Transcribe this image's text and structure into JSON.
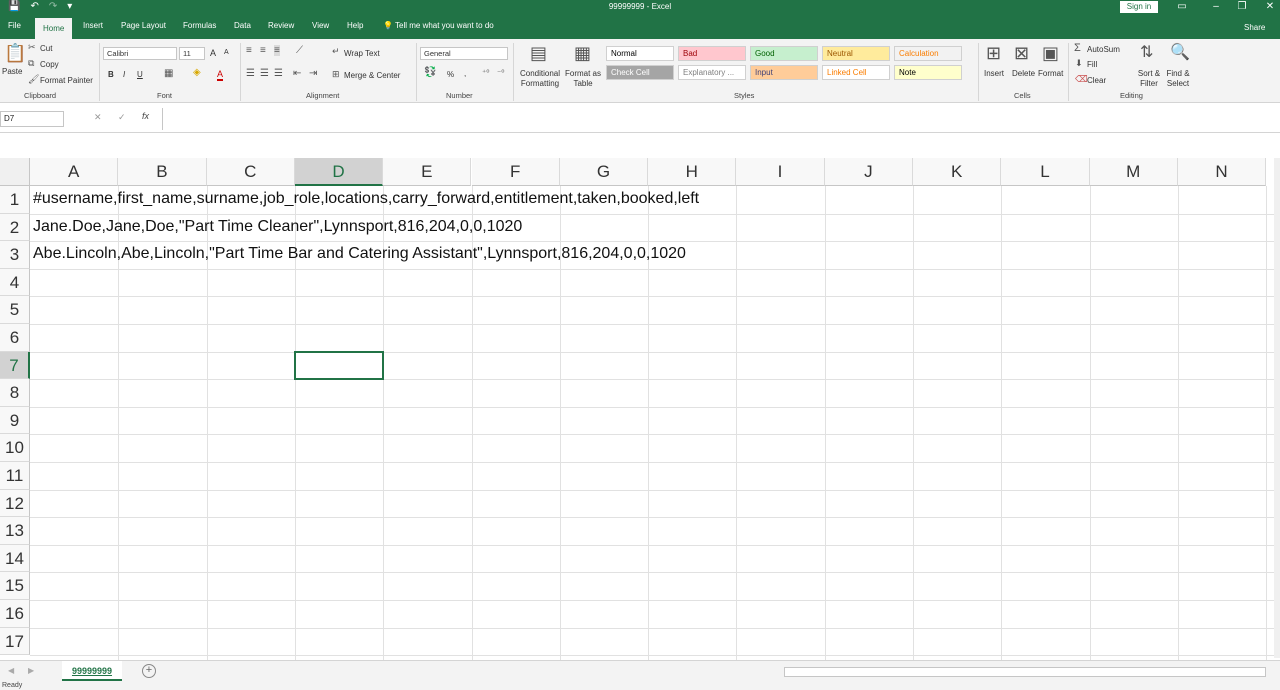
{
  "titlebar": {
    "doc_title": "99999999 - Excel",
    "signin": "Sign in"
  },
  "tabs": [
    {
      "label": "File"
    },
    {
      "label": "Home"
    },
    {
      "label": "Insert"
    },
    {
      "label": "Page Layout"
    },
    {
      "label": "Formulas"
    },
    {
      "label": "Data"
    },
    {
      "label": "Review"
    },
    {
      "label": "View"
    },
    {
      "label": "Help"
    },
    {
      "label": "Tell me what you want to do"
    }
  ],
  "share_label": "Share",
  "ribbon": {
    "clipboard": {
      "paste": "Paste",
      "cut": "Cut",
      "copy": "Copy",
      "format_painter": "Format Painter",
      "label": "Clipboard"
    },
    "font": {
      "name": "Calibri",
      "size": "11",
      "bold": "B",
      "italic": "I",
      "underline": "U",
      "grow": "A",
      "shrink": "A",
      "font_color": "A",
      "label": "Font"
    },
    "alignment": {
      "wrap_text": "Wrap Text",
      "merge_center": "Merge & Center",
      "label": "Alignment"
    },
    "number": {
      "format": "General",
      "percent": "%",
      "comma": ",",
      "label": "Number"
    },
    "styles": {
      "conditional": "Conditional Formatting",
      "format_as_table": "Format as Table",
      "cells": [
        {
          "label": "Normal",
          "bg": "#ffffff",
          "fg": "#000000"
        },
        {
          "label": "Bad",
          "bg": "#ffc7ce",
          "fg": "#9c0006"
        },
        {
          "label": "Good",
          "bg": "#c6efce",
          "fg": "#006100"
        },
        {
          "label": "Neutral",
          "bg": "#ffeb9c",
          "fg": "#9c5700"
        },
        {
          "label": "Calculation",
          "bg": "#f2f2f2",
          "fg": "#fa7d00"
        },
        {
          "label": "Check Cell",
          "bg": "#a5a5a5",
          "fg": "#ffffff"
        },
        {
          "label": "Explanatory ...",
          "bg": "#ffffff",
          "fg": "#7f7f7f"
        },
        {
          "label": "Input",
          "bg": "#ffcc99",
          "fg": "#3f3f76"
        },
        {
          "label": "Linked Cell",
          "bg": "#ffffff",
          "fg": "#fa7d00"
        },
        {
          "label": "Note",
          "bg": "#ffffcc",
          "fg": "#000000"
        }
      ],
      "label": "Styles"
    },
    "cells_group": {
      "insert": "Insert",
      "delete": "Delete",
      "format": "Format",
      "label": "Cells"
    },
    "editing": {
      "autosum": "AutoSum",
      "fill": "Fill",
      "clear": "Clear",
      "sort_filter": "Sort & Filter",
      "find_select": "Find & Select",
      "label": "Editing"
    }
  },
  "formula_bar": {
    "name_box": "D7",
    "fx": "fx",
    "cancel": "✕",
    "enter": "✓",
    "content": ""
  },
  "columns": [
    "A",
    "B",
    "C",
    "D",
    "E",
    "F",
    "G",
    "H",
    "I",
    "J",
    "K",
    "L",
    "M",
    "N"
  ],
  "rows": [
    "1",
    "2",
    "3",
    "4",
    "5",
    "6",
    "7",
    "8",
    "9",
    "10",
    "11",
    "12",
    "13",
    "14",
    "15",
    "16",
    "17"
  ],
  "cells": [
    {
      "row": "1",
      "text": "#username,first_name,surname,job_role,locations,carry_forward,entitlement,taken,booked,left"
    },
    {
      "row": "2",
      "text": "Jane.Doe,Jane,Doe,\"Part Time Cleaner\",Lynnsport,816,204,0,0,1020"
    },
    {
      "row": "3",
      "text": "Abe.Lincoln,Abe,Lincoln,\"Part Time Bar and Catering Assistant\",Lynnsport,816,204,0,0,1020"
    }
  ],
  "selected_cell": "D7",
  "sheet_tab": "99999999",
  "status": "Ready",
  "theme_color": "#217346"
}
